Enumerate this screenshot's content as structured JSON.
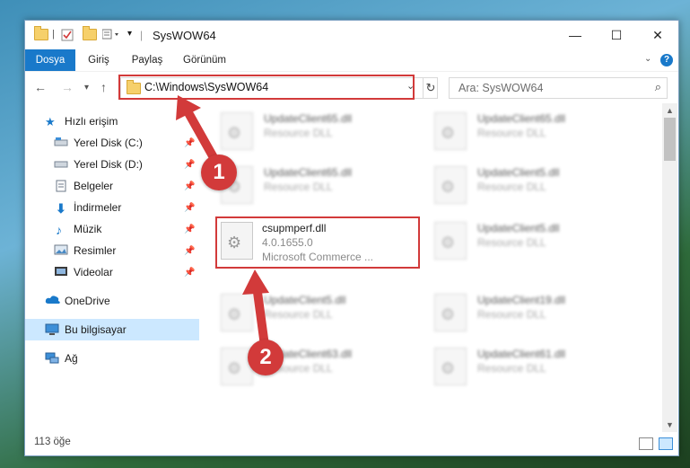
{
  "window": {
    "title": "SysWOW64"
  },
  "ribbon": {
    "tabs": [
      "Dosya",
      "Giriş",
      "Paylaş",
      "Görünüm"
    ],
    "help": "?"
  },
  "address": {
    "path": "C:\\Windows\\SysWOW64"
  },
  "search": {
    "placeholder": "Ara: SysWOW64"
  },
  "sidebar": {
    "items": [
      {
        "label": "Hızlı erişim",
        "icon": "star-icon"
      },
      {
        "label": "Yerel Disk (C:)",
        "icon": "drive-icon",
        "pinned": true
      },
      {
        "label": "Yerel Disk (D:)",
        "icon": "drive-icon",
        "pinned": true
      },
      {
        "label": "Belgeler",
        "icon": "documents-icon",
        "pinned": true
      },
      {
        "label": "İndirmeler",
        "icon": "download-icon",
        "pinned": true
      },
      {
        "label": "Müzik",
        "icon": "music-icon",
        "pinned": true
      },
      {
        "label": "Resimler",
        "icon": "pictures-icon",
        "pinned": true
      },
      {
        "label": "Videolar",
        "icon": "video-icon",
        "pinned": true
      },
      {
        "label": "OneDrive",
        "icon": "cloud-icon"
      },
      {
        "label": "Bu bilgisayar",
        "icon": "computer-icon",
        "selected": true
      },
      {
        "label": "Ağ",
        "icon": "network-icon"
      }
    ]
  },
  "files": {
    "left": [
      {
        "name": "UpdateClient65.dll",
        "sub": "Resource DLL"
      },
      {
        "name": "UpdateClient65.dll",
        "sub": "Resource DLL"
      },
      {
        "name": "csupmperf.dll",
        "version": "4.0.1655.0",
        "company": "Microsoft Commerce ..."
      },
      {
        "name": "UpdateClient5.dll",
        "sub": "Resource DLL"
      },
      {
        "name": "UpdateClient63.dll",
        "sub": "Resource DLL"
      }
    ],
    "right": [
      {
        "name": "UpdateClient65.dll",
        "sub": "Resource DLL"
      },
      {
        "name": "UpdateClient5.dll",
        "sub": "Resource DLL"
      },
      {
        "name": "UpdateClient5.dll",
        "sub": "Resource DLL"
      },
      {
        "name": "UpdateClient19.dll",
        "sub": "Resource DLL"
      },
      {
        "name": "UpdateClient61.dll",
        "sub": "Resource DLL"
      }
    ]
  },
  "status": {
    "count": "113 öğe"
  },
  "callouts": [
    "1",
    "2"
  ],
  "colors": {
    "accent": "#1979ca",
    "highlight": "#d23a3a",
    "selection": "#cce8ff"
  }
}
